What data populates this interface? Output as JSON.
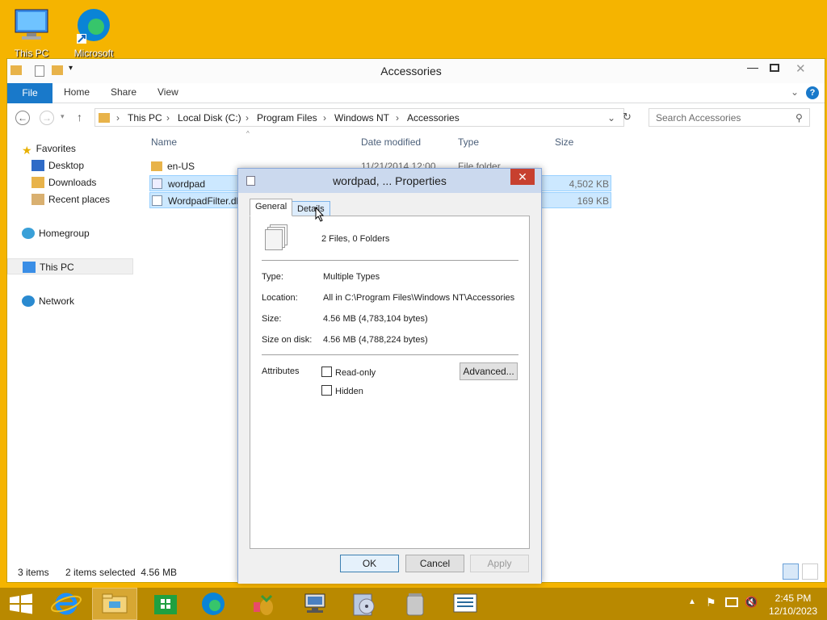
{
  "desktop": {
    "icons": [
      {
        "label": "This PC",
        "icon": "this-pc-icon"
      },
      {
        "label": "Microsoft",
        "icon": "edge-shortcut-icon"
      }
    ]
  },
  "explorer": {
    "title": "Accessories",
    "ribbon_tabs": [
      "File",
      "Home",
      "Share",
      "View"
    ],
    "breadcrumb": [
      "This PC",
      "Local Disk (C:)",
      "Program Files",
      "Windows NT",
      "Accessories"
    ],
    "search_placeholder": "Search Accessories",
    "nav": {
      "favorites": "Favorites",
      "desktop": "Desktop",
      "downloads": "Downloads",
      "recent": "Recent places",
      "homegroup": "Homegroup",
      "thispc": "This PC",
      "network": "Network"
    },
    "columns": {
      "name": "Name",
      "date": "Date modified",
      "type": "Type",
      "size": "Size"
    },
    "files": [
      {
        "name": "en-US",
        "date": "11/21/2014 12:00",
        "type": "File folder",
        "size": ""
      },
      {
        "name": "wordpad",
        "date": "",
        "type": "",
        "size": "4,502 KB"
      },
      {
        "name": "WordpadFilter.dll",
        "date": "",
        "type": "",
        "size": "169 KB"
      }
    ],
    "status": {
      "items": "3 items",
      "selected": "2 items selected  4.56 MB"
    }
  },
  "dialog": {
    "title": "wordpad, ... Properties",
    "close": "✕",
    "tabs": [
      "General",
      "Details"
    ],
    "summary": "2 Files, 0 Folders",
    "rows": [
      {
        "label": "Type:",
        "value": "Multiple Types"
      },
      {
        "label": "Location:",
        "value": "All in C:\\Program Files\\Windows NT\\Accessories"
      },
      {
        "label": "Size:",
        "value": "4.56 MB (4,783,104 bytes)"
      },
      {
        "label": "Size on disk:",
        "value": "4.56 MB (4,788,224 bytes)"
      }
    ],
    "attributes_label": "Attributes",
    "readonly": "Read-only",
    "hidden": "Hidden",
    "advanced": "Advanced...",
    "ok": "OK",
    "cancel": "Cancel",
    "apply": "Apply"
  },
  "taskbar": {
    "time": "2:45 PM",
    "date": "12/10/2023"
  }
}
